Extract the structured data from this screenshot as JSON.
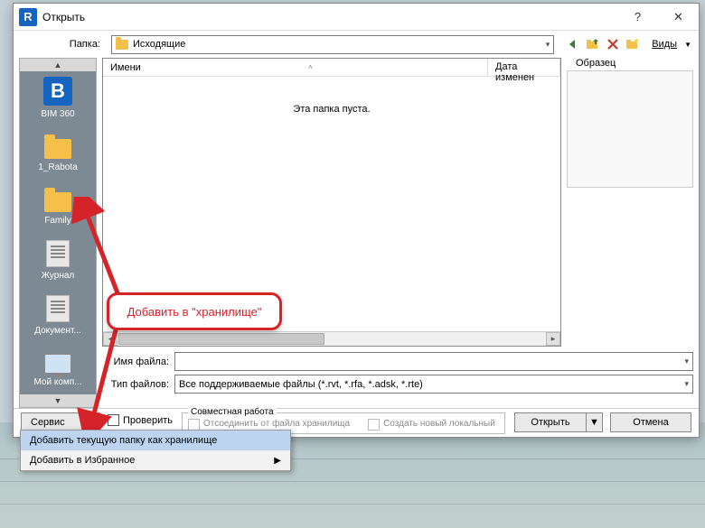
{
  "title": "Открыть",
  "folder_label": "Папка:",
  "folder_value": "Исходящие",
  "views_link": "Виды",
  "preview_label": "Образец",
  "columns": {
    "name": "Имени",
    "date": "Дата изменен"
  },
  "empty_msg": "Эта папка пуста.",
  "filename_label": "Имя файла:",
  "filetype_label": "Тип файлов:",
  "filetype_value": "Все поддерживаемые файлы  (*.rvt, *.rfa, *.adsk, *.rte)",
  "tools_btn": "Сервис",
  "check_label": "Проверить",
  "collab": {
    "legend": "Совместная работа",
    "detach": "Отсоединить от файла хранилища",
    "newlocal": "Создать новый локальный"
  },
  "open_btn": "Открыть",
  "cancel_btn": "Отмена",
  "menu": {
    "add_current": "Добавить текущую папку как хранилище",
    "add_fav": "Добавить в Избранное"
  },
  "places": {
    "bim": "BIM 360",
    "rabota": "1_Rabota",
    "family": "Family",
    "journal": "Журнал",
    "docs": "Документ...",
    "mycomp": "Мой комп..."
  },
  "callout": "Добавить в \"хранилище\""
}
